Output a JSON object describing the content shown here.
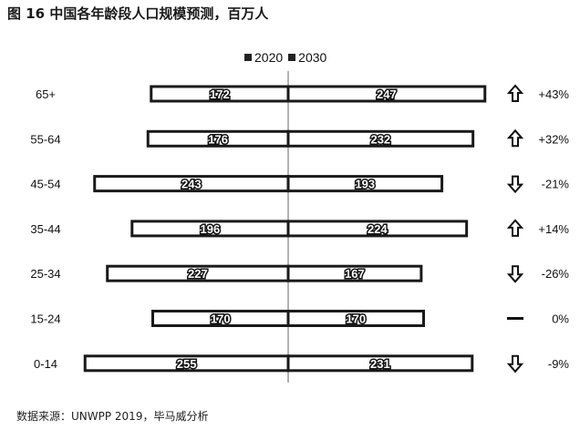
{
  "title": "图 16 中国各年龄段人口规模预测，百万人",
  "source": "数据来源：UNWPP 2019，毕马威分析",
  "chart_data": {
    "type": "bar",
    "orientation": "horizontal-butterfly",
    "categories": [
      "65+",
      "55-64",
      "45-54",
      "35-44",
      "25-34",
      "15-24",
      "0-14"
    ],
    "series": [
      {
        "name": "2020",
        "values": [
          172,
          176,
          243,
          196,
          227,
          170,
          255
        ]
      },
      {
        "name": "2030",
        "values": [
          247,
          232,
          193,
          224,
          167,
          170,
          231
        ]
      }
    ],
    "value_labels": {
      "2020": [
        "172",
        "176",
        "243",
        "196",
        "227",
        "170",
        "255"
      ],
      "2030": [
        "247",
        "232",
        "193",
        "224",
        "167",
        "170",
        "231"
      ]
    },
    "changes": [
      "+43%",
      "+32%",
      "-21%",
      "+14%",
      "-26%",
      "0%",
      "-9%"
    ],
    "change_icons": [
      "arrow-up-icon",
      "arrow-up-icon",
      "arrow-down-icon",
      "arrow-up-icon",
      "arrow-down-icon",
      "dash-icon",
      "arrow-down-icon"
    ],
    "legend": [
      "2020",
      "2030"
    ],
    "legend_position": "top-center",
    "grid": false,
    "colors": {
      "bar_fill": "#ffffff",
      "bar_stroke": "#1a1a1a",
      "axis": "#666666",
      "text": "#111111"
    }
  }
}
